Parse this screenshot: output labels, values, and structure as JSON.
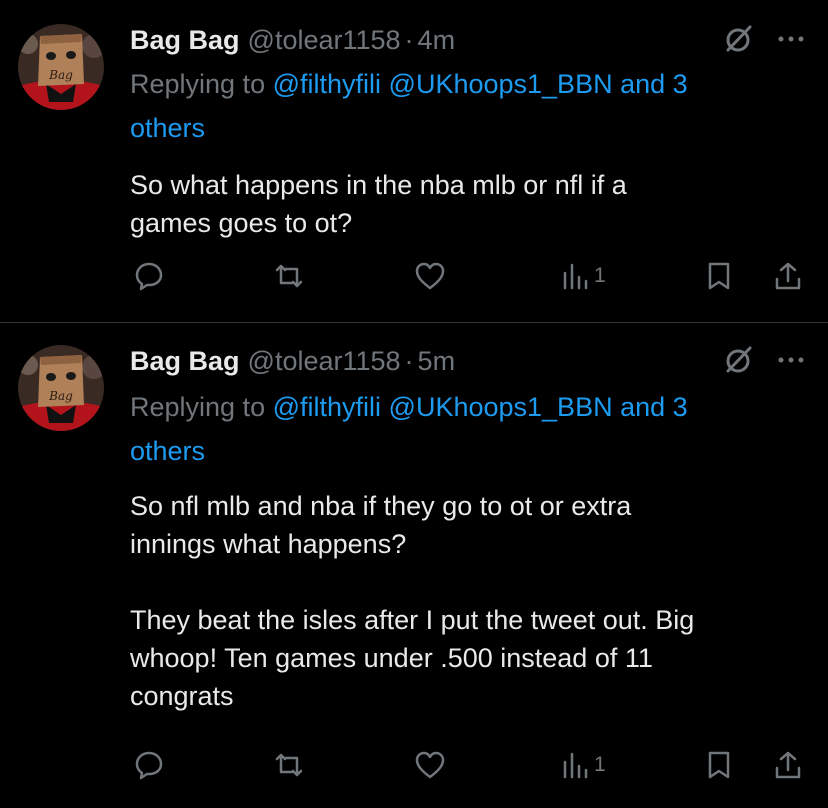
{
  "tweets": [
    {
      "author_name": "Bag Bag",
      "handle": "@tolear1158",
      "time": "4m",
      "reply_prefix": "Replying to",
      "mention_1": "@filthyfili",
      "mention_2": "@UKhoops1_BBN",
      "and_others": "and 3",
      "others": "others",
      "avatar_text": "Bag",
      "body": [
        "So what happens in the nba mlb or nfl if a",
        "games goes to ot?"
      ],
      "views": "1"
    },
    {
      "author_name": "Bag Bag",
      "handle": "@tolear1158",
      "time": "5m",
      "reply_prefix": "Replying to",
      "mention_1": "@filthyfili",
      "mention_2": "@UKhoops1_BBN",
      "and_others": "and 3",
      "others": "others",
      "avatar_text": "Bag",
      "body": [
        "So nfl mlb and nba if they go to ot or extra",
        "innings what happens?",
        "",
        "They beat the isles after I put the tweet out.  Big",
        "whoop!  Ten games under .500 instead of 11",
        "congrats"
      ],
      "views": "1"
    }
  ],
  "colors": {
    "background": "#000000",
    "text": "#e7e9ea",
    "muted": "#71767b",
    "link": "#1d9bf0",
    "divider": "#2f3336"
  },
  "icons": [
    "grok-icon",
    "more-icon",
    "reply-icon",
    "retweet-icon",
    "like-icon",
    "views-icon",
    "bookmark-icon",
    "share-icon"
  ]
}
